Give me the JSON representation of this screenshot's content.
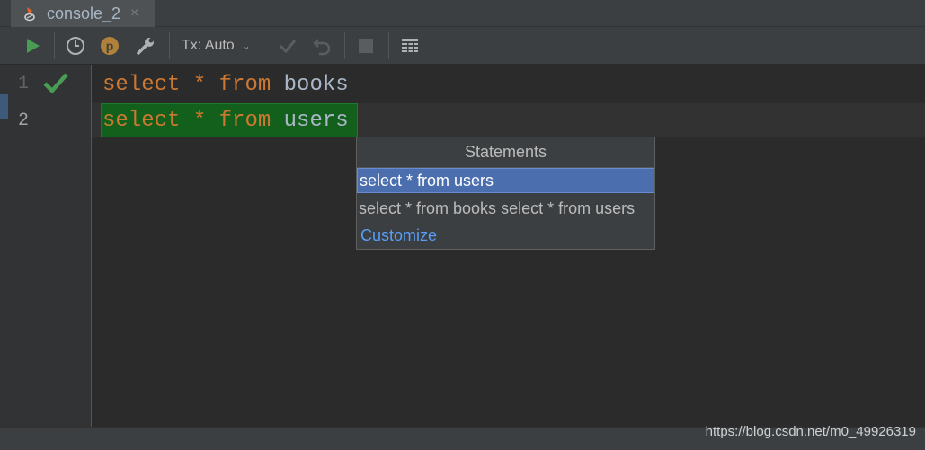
{
  "tab": {
    "label": "console_2",
    "close": "×"
  },
  "toolbar": {
    "run_icon": "play-icon",
    "history_icon": "clock-icon",
    "plan_label": "p",
    "settings_icon": "wrench-icon",
    "tx_label": "Tx: Auto",
    "tx_chevron": "⌄",
    "commit_icon": "check-icon",
    "rollback_icon": "undo-icon",
    "stop_icon": "stop-icon",
    "table_icon": "table-icon"
  },
  "editor": {
    "lines": [
      {
        "number": "1",
        "keyword1": "select",
        "star": "*",
        "keyword2": "from",
        "table": "books",
        "status_icon": "check-icon"
      },
      {
        "number": "2",
        "keyword1": "select",
        "star": "*",
        "keyword2": "from",
        "table": "users"
      }
    ]
  },
  "popup": {
    "title": "Statements",
    "items": [
      "select * from users",
      "select * from books select * from users"
    ],
    "selected_index": 0,
    "customize": "Customize"
  },
  "watermark": "https://blog.csdn.net/m0_49926319",
  "colors": {
    "background": "#2b2b2b",
    "keyword": "#cc7832",
    "identifier": "#a9b7c6",
    "highlight": "#12601c",
    "selection": "#4b6eaf",
    "link": "#589df6",
    "run": "#499c54"
  }
}
